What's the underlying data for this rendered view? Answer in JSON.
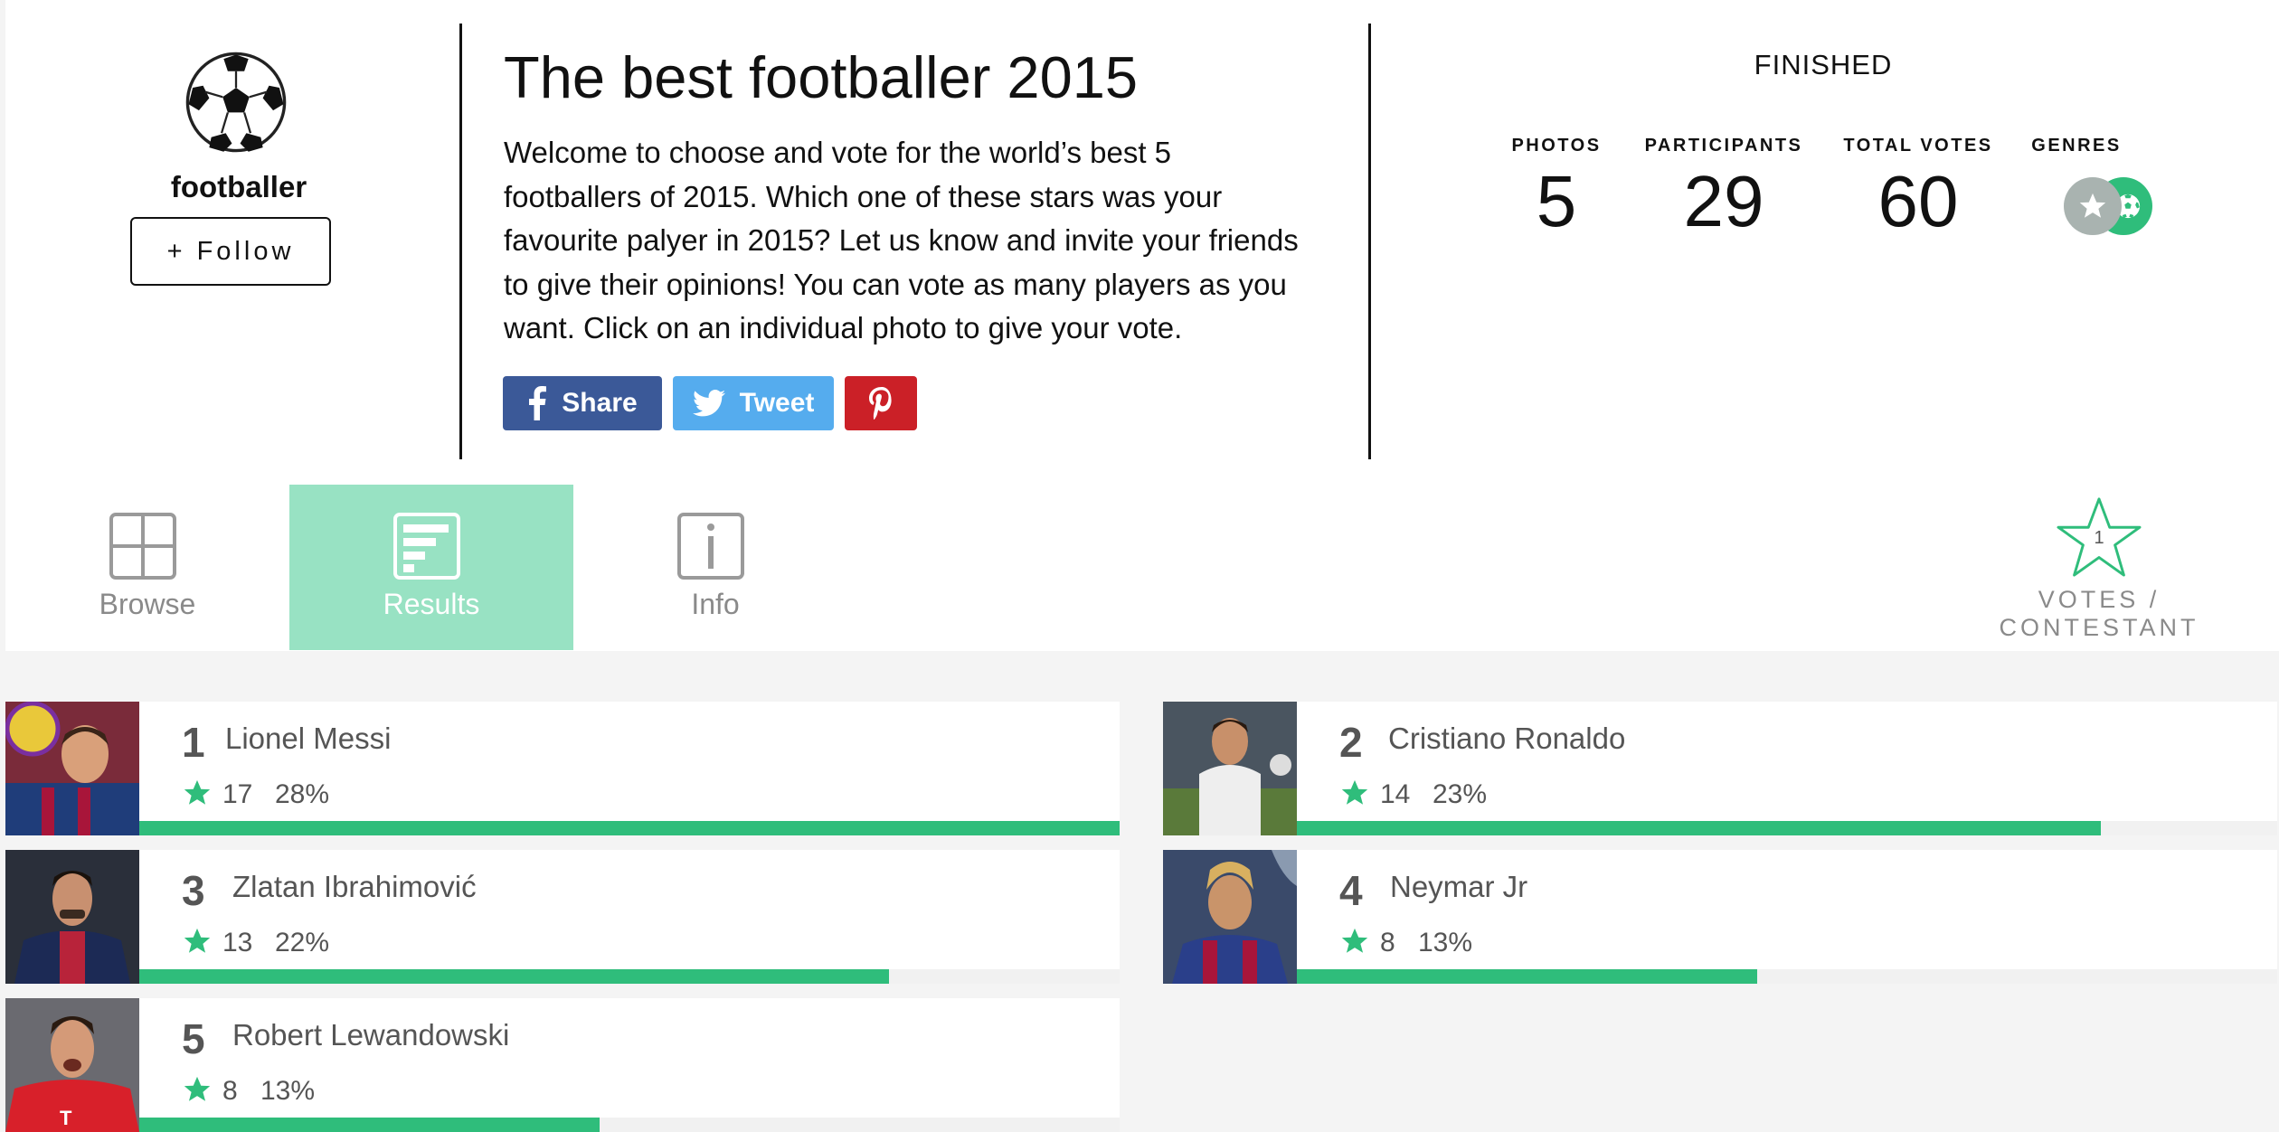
{
  "profile": {
    "username": "footballer",
    "follow_label": "+ Follow"
  },
  "poll": {
    "title": "The best footballer 2015",
    "description_lines": [
      "Welcome to choose and vote for the world’s best 5",
      "footballers of 2015. Which one of these stars was your",
      "favourite palyer in 2015? Let us know and invite your friends",
      "to give their opinions! You can vote as many players as you",
      "want. Click on an individual photo to give your vote."
    ]
  },
  "share": {
    "facebook_label": "Share",
    "twitter_label": "Tweet",
    "colors": {
      "facebook": "#3b5998",
      "twitter": "#55acee",
      "pinterest": "#cb2027"
    }
  },
  "status": {
    "state": "FINISHED",
    "photos_label": "PHOTOS",
    "photos": "5",
    "participants_label": "PARTICIPANTS",
    "participants": "29",
    "total_votes_label": "TOTAL VOTES",
    "total_votes": "60",
    "genres_label": "GENRES",
    "genres": [
      "star-icon",
      "soccer-ball-icon"
    ]
  },
  "tabs": [
    {
      "label": "Browse",
      "icon": "grid-icon",
      "active": false
    },
    {
      "label": "Results",
      "icon": "results-icon",
      "active": true
    },
    {
      "label": "Info",
      "icon": "info-icon",
      "active": false
    }
  ],
  "votes_per_contestant": {
    "count": "1",
    "label_line1": "VOTES /",
    "label_line2": "CONTESTANT"
  },
  "results": [
    {
      "rank": "1",
      "name": "Lionel Messi",
      "votes": "17",
      "percent": "28%",
      "share": 1.0
    },
    {
      "rank": "2",
      "name": "Cristiano Ronaldo",
      "votes": "14",
      "percent": "23%",
      "share": 0.82
    },
    {
      "rank": "3",
      "name": "Zlatan Ibrahimović",
      "votes": "13",
      "percent": "22%",
      "share": 0.765
    },
    {
      "rank": "4",
      "name": "Neymar Jr",
      "votes": "8",
      "percent": "13%",
      "share": 0.47
    },
    {
      "rank": "5",
      "name": "Robert Lewandowski",
      "votes": "8",
      "percent": "13%",
      "share": 0.47
    }
  ],
  "colors": {
    "accent": "#2fbd7b",
    "tab_active": "#98e2c3"
  }
}
